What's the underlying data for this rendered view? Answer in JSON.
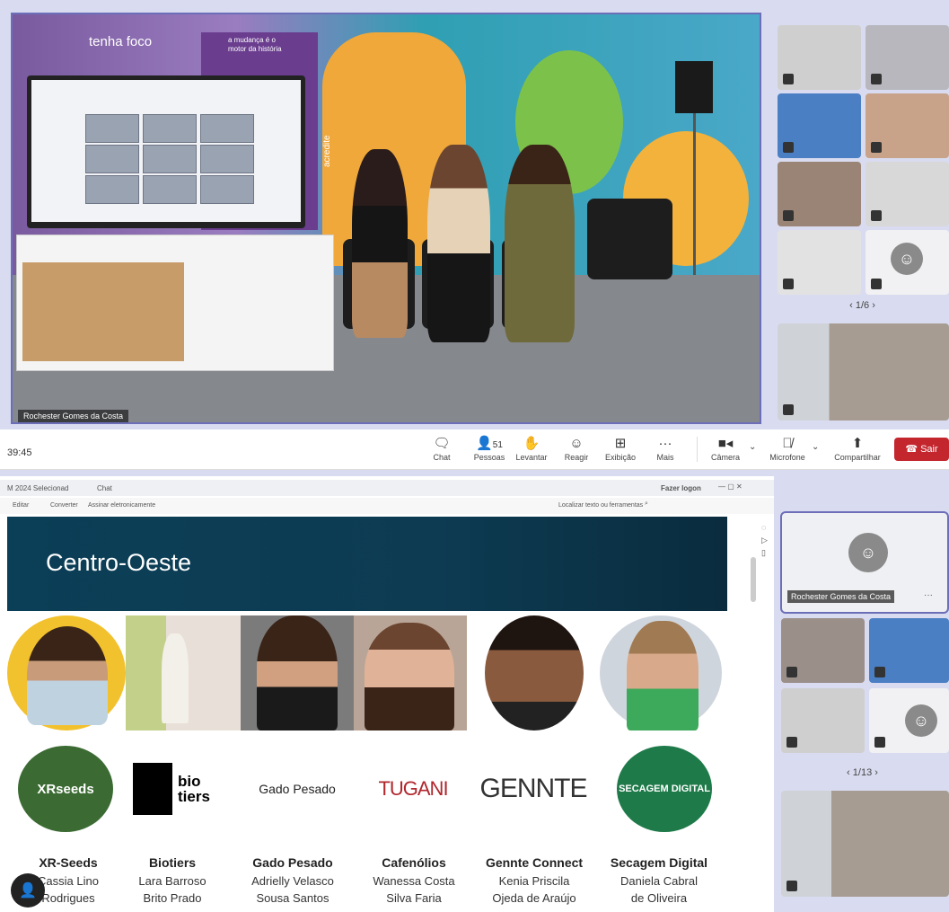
{
  "stage": {
    "wall_texts": [
      "tenha foco",
      "a mudança é o motor da história",
      "acredite"
    ],
    "presenter_name": "Rochester Gomes da Costa"
  },
  "top_grid": {
    "pager": "1/6"
  },
  "toolbar": {
    "clock": "39:45",
    "buttons": [
      {
        "label": "Chat",
        "icon": "chat-icon"
      },
      {
        "label": "Pessoas",
        "count": "51",
        "icon": "people-icon"
      },
      {
        "label": "Levantar",
        "icon": "hand-icon"
      },
      {
        "label": "Reagir",
        "icon": "smile-icon"
      },
      {
        "label": "Exibição",
        "icon": "grid-icon"
      },
      {
        "label": "Mais",
        "icon": "more-icon"
      },
      {
        "label": "Câmera",
        "icon": "camera-icon"
      },
      {
        "label": "Microfone",
        "icon": "mic-off-icon"
      },
      {
        "label": "Compartilhar",
        "icon": "share-icon"
      }
    ],
    "leave": "Sair"
  },
  "browser": {
    "tab_title": "M 2024 Selecionad",
    "tab2": "Chat",
    "login": "Fazer logon",
    "menu": [
      "Editar",
      "Converter",
      "Assinar eletronicamente"
    ],
    "search": "Localizar texto ou ferramentas"
  },
  "slide": {
    "title": "Centro-Oeste",
    "startups": [
      {
        "name": "XR-Seeds",
        "founder1": "Cassia Lino",
        "founder2": "Rodrigues",
        "logo": "XRseeds"
      },
      {
        "name": "Biotiers",
        "founder1": "Lara Barroso",
        "founder2": "Brito Prado",
        "logo": "bio tiers"
      },
      {
        "name": "Gado Pesado",
        "founder1": "Adrielly Velasco",
        "founder2": "Sousa Santos",
        "logo": "Gado Pesado"
      },
      {
        "name": "Cafenólios",
        "founder1": "Wanessa Costa",
        "founder2": "Silva Faria",
        "logo": "TUGANI"
      },
      {
        "name": "Gennte Connect",
        "founder1": "Kenia Priscila",
        "founder2": "Ojeda de Araújo",
        "logo": "GENNTE"
      },
      {
        "name": "Secagem Digital",
        "founder1": "Daniela Cabral",
        "founder2": "de Oliveira",
        "logo": "SECAGEM DIGITAL"
      }
    ]
  },
  "bottom_panel": {
    "self_name": "Rochester Gomes da Costa",
    "pager": "1/13"
  },
  "colors": {
    "accent": "#6c6fb8",
    "leave": "#c4262e",
    "banner": "#0b3f57"
  }
}
